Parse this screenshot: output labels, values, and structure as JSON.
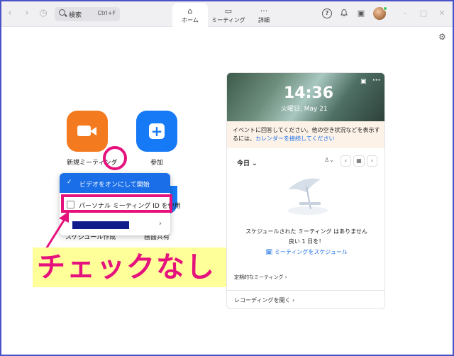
{
  "topbar": {
    "back_icon": "‹",
    "forward_icon": "›",
    "history_icon": "◷",
    "search_placeholder": "検索",
    "search_shortcut": "Ctrl+F",
    "tabs": [
      {
        "label": "ホーム",
        "icon": "home-icon",
        "active": true
      },
      {
        "label": "ミーティング",
        "icon": "video-icon",
        "active": false
      },
      {
        "label": "詳細",
        "icon": "more-icon",
        "active": false
      }
    ],
    "help_icon": "?",
    "bell_icon": "🔔",
    "calendar_icon": "▣",
    "minimize": "–",
    "maximize": "□",
    "close": "✕"
  },
  "settings_icon": "⚙",
  "actions": {
    "new_meeting": "新規ミーティング",
    "new_meeting_chevron": "⌄",
    "join": "参加",
    "schedule_partial": "スケジュール作成",
    "share_partial": "画面共有"
  },
  "dropdown": {
    "item1_check": "✓",
    "item1_label": "ビデオをオンにして開始",
    "item2_label": "パーソナル ミーティング ID を使用",
    "item2_checked": false,
    "item3_arrow": "›"
  },
  "annotation": {
    "text": "チェックなし"
  },
  "calendar_card": {
    "time": "14:36",
    "date": "火曜日, May 21",
    "notice_text": "イベントに回答してください。他の空き状況などを表示するには、",
    "notice_link": "カレンダーを接続してください",
    "today_label": "今日 ⌄",
    "empty_line1": "スケジュールされた ミーティング はありません",
    "empty_line2": "良い 1 日を！",
    "schedule_link": "ミーティングをスケジュール",
    "recurring_label": "定期的なミーティング ›",
    "recording_label": "レコーディングを開く ›"
  },
  "colors": {
    "accent": "#1a6fe8",
    "orange": "#f47a20",
    "highlight_pink": "#e5127d",
    "callout_yellow": "#ffff99",
    "frame_border": "#4a52c8"
  }
}
